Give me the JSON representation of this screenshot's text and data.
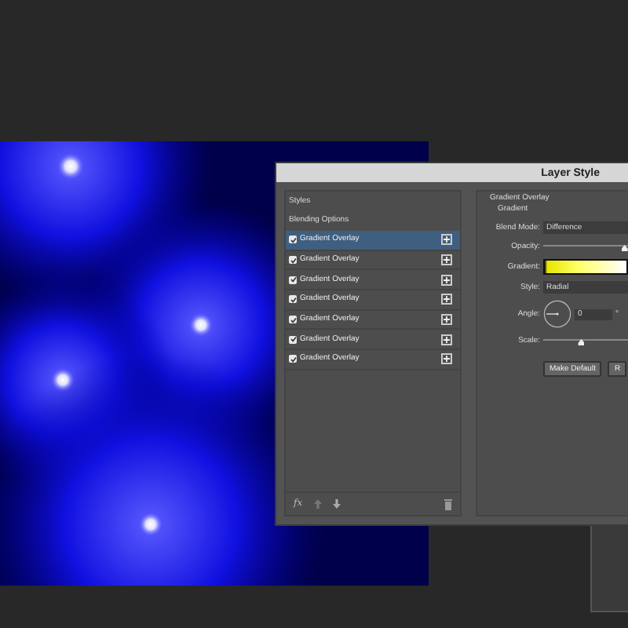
{
  "window": {
    "title": "Layer Style"
  },
  "styles_panel": {
    "heading": "Styles",
    "blending_options": "Blending Options",
    "effects": [
      {
        "label": "Gradient Overlay",
        "checked": true,
        "selected": true
      },
      {
        "label": "Gradient Overlay",
        "checked": true,
        "selected": false
      },
      {
        "label": "Gradient Overlay",
        "checked": true,
        "selected": false
      },
      {
        "label": "Gradient Overlay",
        "checked": true,
        "selected": false
      },
      {
        "label": "Gradient Overlay",
        "checked": true,
        "selected": false
      },
      {
        "label": "Gradient Overlay",
        "checked": true,
        "selected": false
      },
      {
        "label": "Gradient Overlay",
        "checked": true,
        "selected": false
      }
    ],
    "fx_label": "fx"
  },
  "settings": {
    "section": "Gradient Overlay",
    "subsection": "Gradient",
    "blend_mode": {
      "label": "Blend Mode:",
      "value": "Difference"
    },
    "opacity": {
      "label": "Opacity:",
      "level": 0.96
    },
    "gradient": {
      "label": "Gradient:"
    },
    "style": {
      "label": "Style:",
      "value": "Radial"
    },
    "angle": {
      "label": "Angle:",
      "value": "0",
      "unit": "°"
    },
    "scale": {
      "label": "Scale:",
      "level": 0.45
    },
    "buttons": [
      "Make Default",
      "R"
    ]
  }
}
